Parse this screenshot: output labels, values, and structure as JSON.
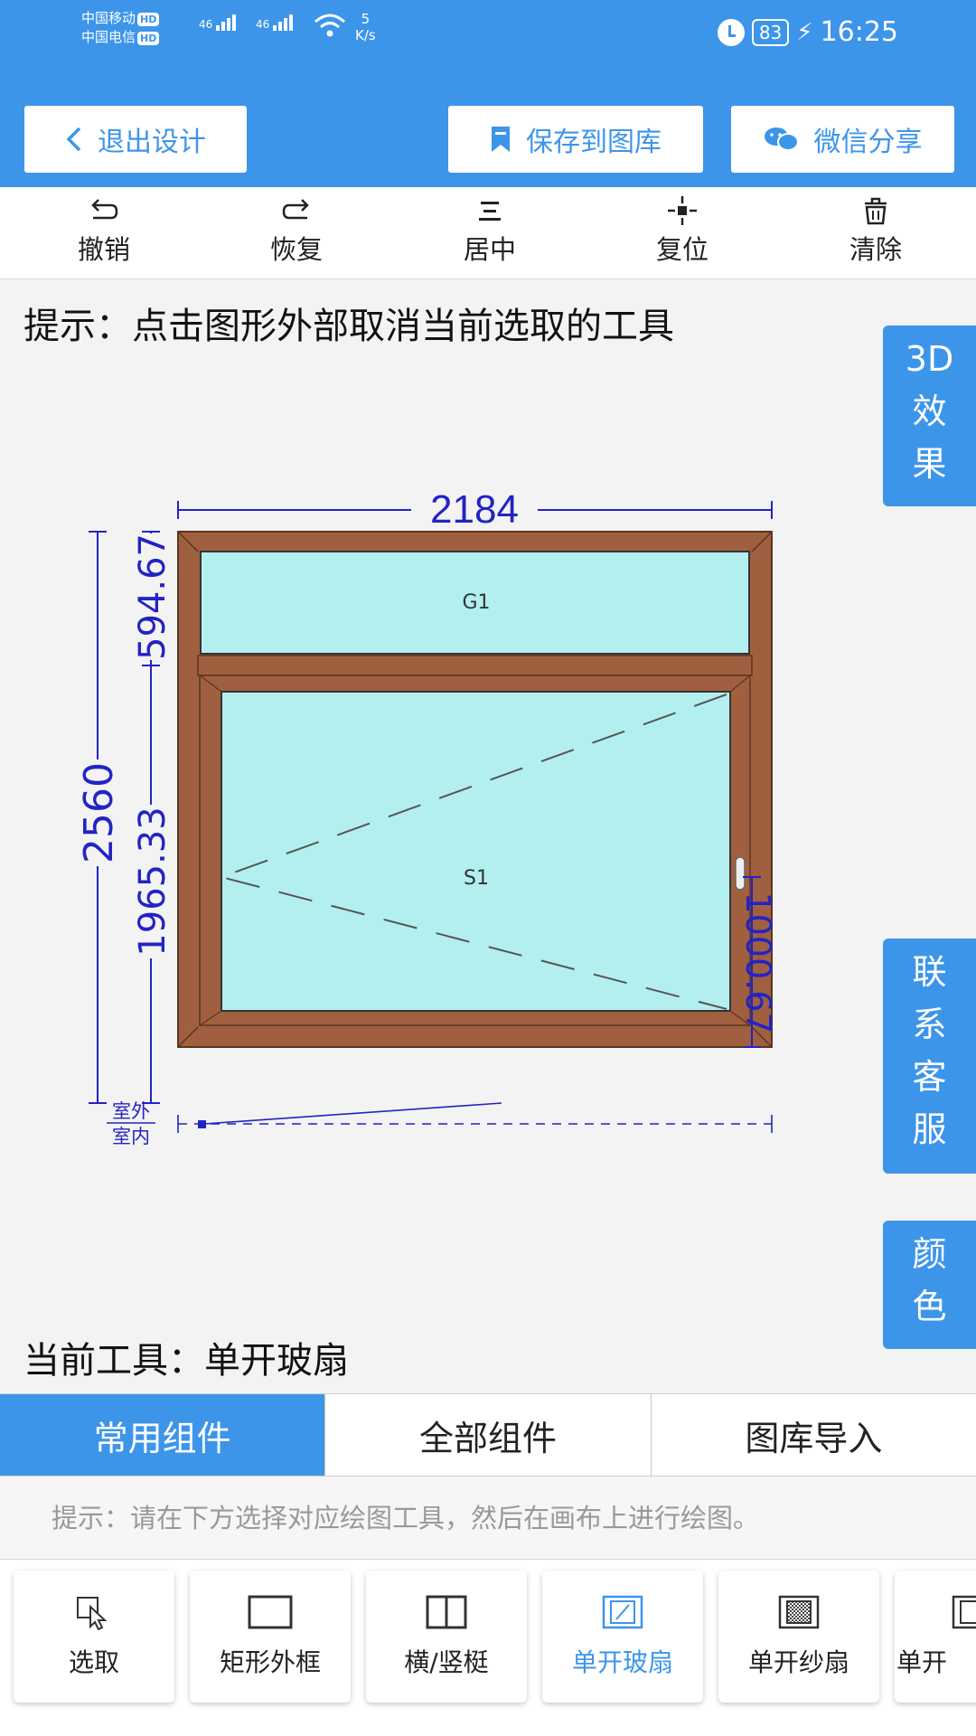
{
  "status_bar": {
    "carrier1": "中国移动",
    "carrier2": "中国电信",
    "hd": "HD",
    "net1": "46",
    "net2": "46",
    "speed_value": "5",
    "speed_unit": "K/s",
    "battery": "83",
    "time": "16:25"
  },
  "header": {
    "exit_label": "退出设计",
    "save_label": "保存到图库",
    "share_label": "微信分享"
  },
  "toolbar": {
    "undo": "撤销",
    "redo": "恢复",
    "center": "居中",
    "reset": "复位",
    "clear": "清除"
  },
  "hint": "提示：点击图形外部取消当前选取的工具",
  "side_buttons": {
    "three_d": [
      "3D",
      "效",
      "果"
    ],
    "support": [
      "联",
      "系",
      "客",
      "服"
    ],
    "color": [
      "颜",
      "色"
    ]
  },
  "drawing": {
    "total_width": "2184",
    "total_height": "2560",
    "top_height": "594.67",
    "bottom_height": "1965.33",
    "handle_height": "1000.67",
    "top_pane_label": "G1",
    "sash_label": "S1",
    "outside_label": "室外",
    "inside_label": "室内",
    "colors": {
      "frame": "#a0603f",
      "glass": "#b3efef",
      "dimension": "#2323c4"
    }
  },
  "current_tool": "当前工具：单开玻扇",
  "tabs": [
    "常用组件",
    "全部组件",
    "图库导入"
  ],
  "tip2": "提示：请在下方选择对应绘图工具，然后在画布上进行绘图。",
  "palette": [
    {
      "label": "选取",
      "icon": "cursor-icon"
    },
    {
      "label": "矩形外框",
      "icon": "rectangle-icon"
    },
    {
      "label": "横/竖梃",
      "icon": "mullion-icon"
    },
    {
      "label": "单开玻扇",
      "icon": "glass-sash-icon"
    },
    {
      "label": "单开纱扇",
      "icon": "screen-sash-icon"
    },
    {
      "label": "单开",
      "icon": "sash-icon"
    }
  ],
  "accent_color": "#3d95ea"
}
